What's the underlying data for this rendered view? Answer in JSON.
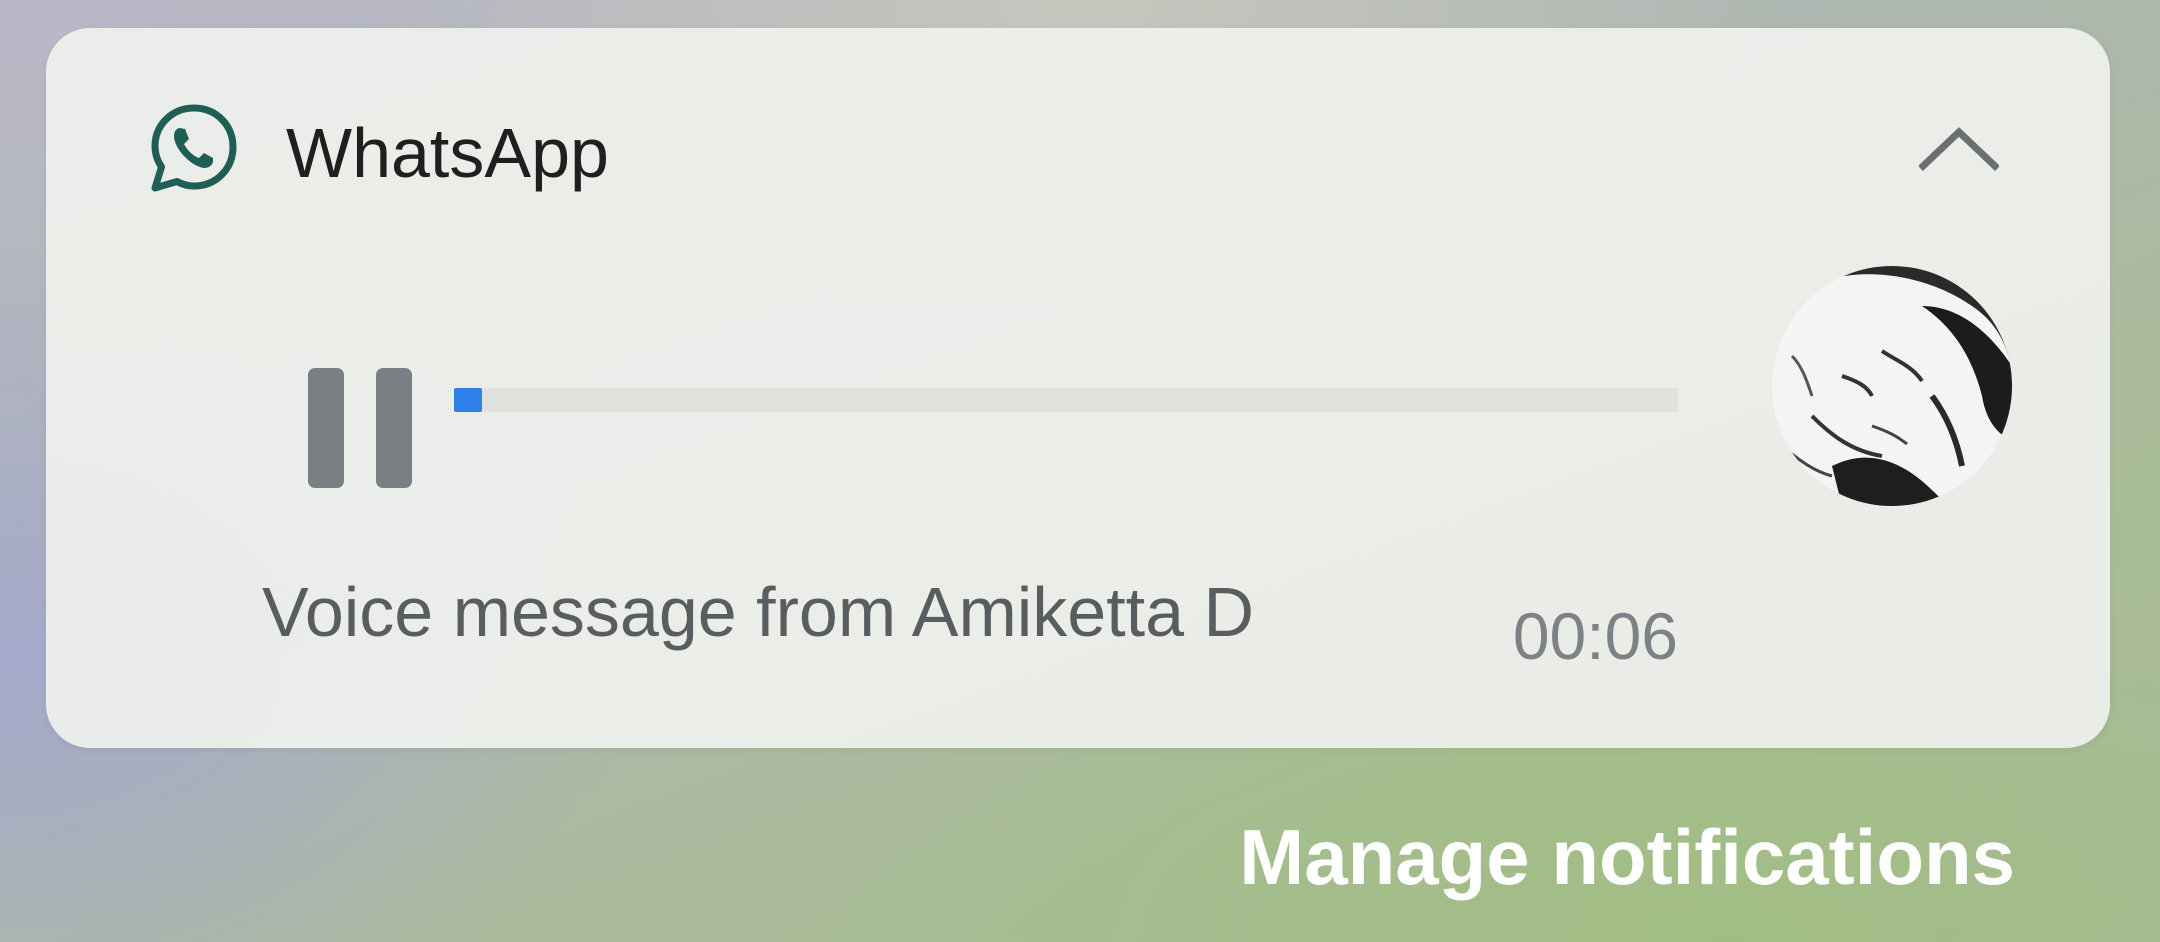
{
  "notification": {
    "app_name": "WhatsApp",
    "app_icon": "whatsapp-icon",
    "collapse_icon": "chevron-up-icon",
    "player": {
      "state_icon": "pause-icon",
      "progress_fraction": 0.01,
      "message_text": "Voice message from Amiketta D",
      "duration": "00:06"
    },
    "avatar": "contact-avatar"
  },
  "footer": {
    "manage_label": "Manage notifications"
  },
  "colors": {
    "accent": "#2f7fe8",
    "whatsapp_icon": "#1f5e52",
    "pause_bar": "#7a7f84"
  }
}
